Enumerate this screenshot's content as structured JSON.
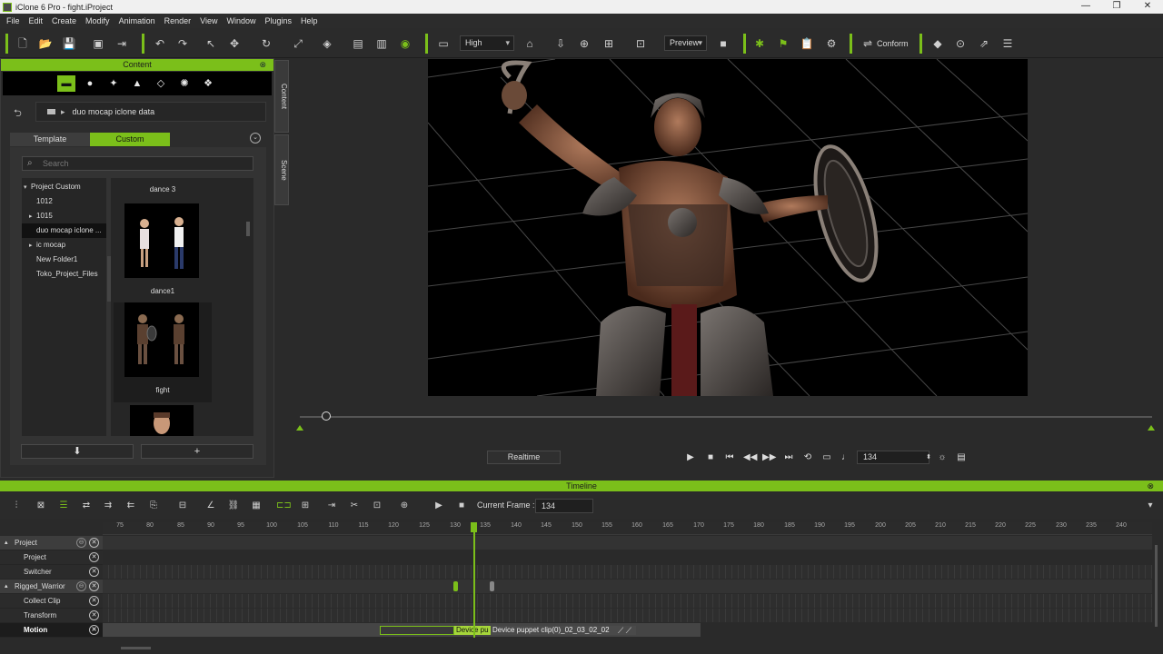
{
  "window": {
    "title": "iClone 6 Pro - fight.iProject",
    "controls": [
      "—",
      "❐",
      "✕"
    ]
  },
  "menu": [
    "File",
    "Edit",
    "Create",
    "Modify",
    "Animation",
    "Render",
    "View",
    "Window",
    "Plugins",
    "Help"
  ],
  "toolbar": {
    "quality": "High",
    "render_mode": "Preview",
    "conform_label": "Conform"
  },
  "content_panel": {
    "title": "Content",
    "path": "duo mocap iclone data",
    "tabs": [
      "Template",
      "Custom"
    ],
    "active_tab": "Custom",
    "search_placeholder": "Search",
    "tree": [
      {
        "label": "Project Custom",
        "expand": "▾",
        "level": 0
      },
      {
        "label": "1012",
        "expand": "",
        "level": 1
      },
      {
        "label": "1015",
        "expand": "▸",
        "level": 1
      },
      {
        "label": "duo mocap iclone ...",
        "expand": "",
        "level": 1,
        "selected": true
      },
      {
        "label": "ic mocap",
        "expand": "▸",
        "level": 1
      },
      {
        "label": "New Folder1",
        "expand": "",
        "level": 1
      },
      {
        "label": "Toko_Project_Files",
        "expand": "",
        "level": 1
      }
    ],
    "thumbs": [
      "dance 3",
      "dance1",
      "fight"
    ],
    "side_tabs": [
      "Content",
      "Scene"
    ],
    "buttons": [
      "⬇",
      "+"
    ]
  },
  "playback": {
    "realtime_label": "Realtime",
    "frame": "134"
  },
  "timeline": {
    "title": "Timeline",
    "current_frame_label": "Current Frame :",
    "current_frame": "134",
    "ruler": [
      "75",
      "80",
      "85",
      "90",
      "95",
      "100",
      "105",
      "110",
      "115",
      "120",
      "125",
      "130",
      "135",
      "140",
      "145",
      "150",
      "155",
      "160",
      "165",
      "170",
      "175",
      "180",
      "185",
      "190",
      "195",
      "200",
      "205",
      "210",
      "215",
      "220",
      "225",
      "230",
      "235",
      "240"
    ],
    "tracks": [
      {
        "label": "Project",
        "group": true
      },
      {
        "label": "Project",
        "group": false
      },
      {
        "label": "Switcher",
        "group": false
      },
      {
        "label": "Rigged_Warrior",
        "group": true
      },
      {
        "label": "Collect Clip",
        "group": false
      },
      {
        "label": "Transform",
        "group": false
      },
      {
        "label": "Motion",
        "group": false,
        "selected": true
      }
    ],
    "clip_a": "Device pu",
    "clip_b": "Device puppet clip(0)_02_03_02_02",
    "accent": "#7bbf1a"
  }
}
